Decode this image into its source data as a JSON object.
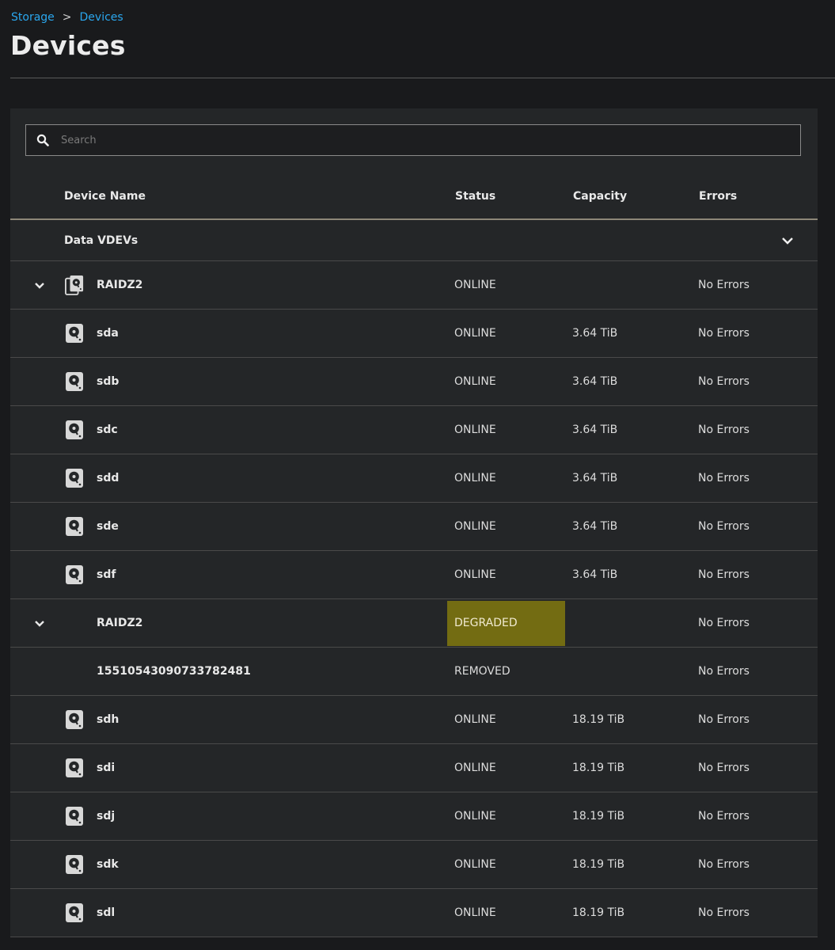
{
  "breadcrumb": {
    "parent": "Storage",
    "separator": ">",
    "current": "Devices"
  },
  "page": {
    "title": "Devices"
  },
  "search": {
    "placeholder": "Search",
    "value": ""
  },
  "table": {
    "headers": {
      "name": "Device Name",
      "status": "Status",
      "capacity": "Capacity",
      "errors": "Errors"
    },
    "group": {
      "label": "Data VDEVs"
    },
    "rows": [
      {
        "name": "RAIDZ2",
        "status": "ONLINE",
        "capacity": "",
        "errors": "No Errors",
        "icon": "vdev-icon",
        "expandable": true
      },
      {
        "name": "sda",
        "status": "ONLINE",
        "capacity": "3.64 TiB",
        "errors": "No Errors",
        "icon": "disk-icon"
      },
      {
        "name": "sdb",
        "status": "ONLINE",
        "capacity": "3.64 TiB",
        "errors": "No Errors",
        "icon": "disk-icon"
      },
      {
        "name": "sdc",
        "status": "ONLINE",
        "capacity": "3.64 TiB",
        "errors": "No Errors",
        "icon": "disk-icon"
      },
      {
        "name": "sdd",
        "status": "ONLINE",
        "capacity": "3.64 TiB",
        "errors": "No Errors",
        "icon": "disk-icon"
      },
      {
        "name": "sde",
        "status": "ONLINE",
        "capacity": "3.64 TiB",
        "errors": "No Errors",
        "icon": "disk-icon"
      },
      {
        "name": "sdf",
        "status": "ONLINE",
        "capacity": "3.64 TiB",
        "errors": "No Errors",
        "icon": "disk-icon"
      },
      {
        "name": "RAIDZ2",
        "status": "DEGRADED",
        "capacity": "",
        "errors": "No Errors",
        "icon": "",
        "expandable": true,
        "highlight": "#736c12"
      },
      {
        "name": "15510543090733782481",
        "status": "REMOVED",
        "capacity": "",
        "errors": "No Errors",
        "icon": ""
      },
      {
        "name": "sdh",
        "status": "ONLINE",
        "capacity": "18.19 TiB",
        "errors": "No Errors",
        "icon": "disk-icon"
      },
      {
        "name": "sdi",
        "status": "ONLINE",
        "capacity": "18.19 TiB",
        "errors": "No Errors",
        "icon": "disk-icon"
      },
      {
        "name": "sdj",
        "status": "ONLINE",
        "capacity": "18.19 TiB",
        "errors": "No Errors",
        "icon": "disk-icon"
      },
      {
        "name": "sdk",
        "status": "ONLINE",
        "capacity": "18.19 TiB",
        "errors": "No Errors",
        "icon": "disk-icon"
      },
      {
        "name": "sdl",
        "status": "ONLINE",
        "capacity": "18.19 TiB",
        "errors": "No Errors",
        "icon": "disk-icon"
      }
    ]
  },
  "colors": {
    "link": "#2aa7ee",
    "background": "#191a1c",
    "panel": "#242628",
    "degraded_highlight": "#736c12"
  }
}
